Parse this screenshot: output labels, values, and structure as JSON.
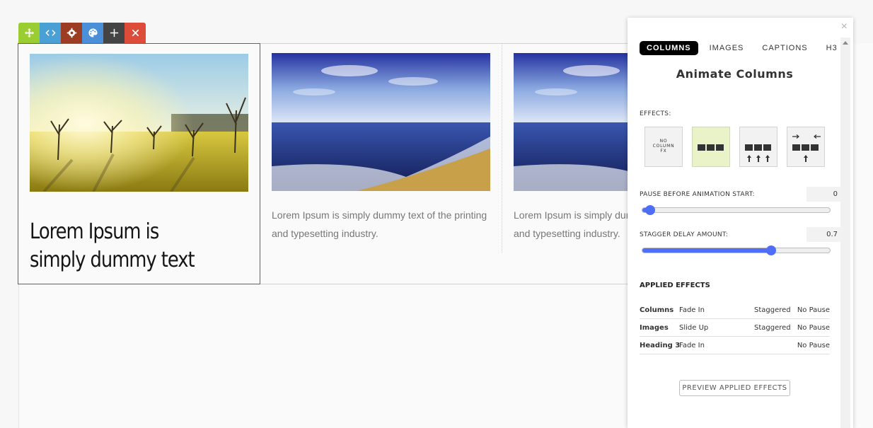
{
  "colors": {
    "toolbar_move": "#9acd32",
    "toolbar_code": "#4a9fd5",
    "toolbar_settings": "#9c3d23",
    "toolbar_style": "#4a8fd8",
    "toolbar_add": "#444444",
    "toolbar_delete": "#dd4b39",
    "slider_accent": "#4f6ef7",
    "selected_fx": "#eaf3c8",
    "column_outline": "#b5451b"
  },
  "toolbar": {
    "buttons": [
      "move-icon",
      "code-icon",
      "gear-icon",
      "palette-icon",
      "plus-icon",
      "close-icon"
    ]
  },
  "columns": [
    {
      "image": "sunny-field-image",
      "heading": "Lorem Ipsum is simply dummy text"
    },
    {
      "image": "sea-beach-image",
      "caption": "Lorem Ipsum is simply dummy text of the printing and typesetting industry."
    },
    {
      "image": "sea-beach-image",
      "caption": "Lorem Ipsum is simply dummy text of the printing and typesetting industry."
    }
  ],
  "panel": {
    "close": "×",
    "tabs": [
      "COLUMNS",
      "IMAGES",
      "CAPTIONS",
      "H3"
    ],
    "active_tab": "COLUMNS",
    "title": "Animate Columns",
    "effects_label": "EFFECTS:",
    "effects": [
      {
        "label": "NO COLUMN FX",
        "icon": "no-fx"
      },
      {
        "label": "",
        "icon": "fade-in-icon",
        "selected": true
      },
      {
        "label": "",
        "icon": "slide-up-icon"
      },
      {
        "label": "",
        "icon": "slide-in-icon"
      }
    ],
    "pause_label": "PAUSE BEFORE ANIMATION START:",
    "pause_value": "0",
    "pause_fraction": 0.04,
    "stagger_label": "STAGGER DELAY AMOUNT:",
    "stagger_value": "0.7",
    "stagger_fraction": 0.685,
    "applied_title": "APPLIED EFFECTS",
    "applied": [
      {
        "target": "Columns",
        "effect": "Fade In",
        "stagger": "Staggered",
        "pause": "No Pause"
      },
      {
        "target": "Images",
        "effect": "Slide Up",
        "stagger": "Staggered",
        "pause": "No Pause"
      },
      {
        "target": "Heading 3",
        "effect": "Fade In",
        "stagger": "",
        "pause": "No Pause"
      }
    ],
    "preview_button": "PREVIEW APPLIED EFFECTS"
  }
}
